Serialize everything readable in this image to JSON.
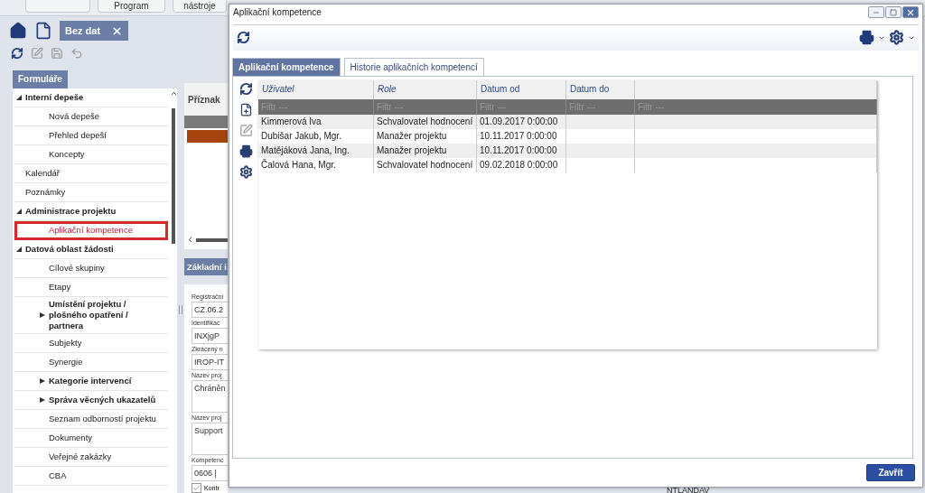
{
  "top_nav": [
    {
      "label": "Program"
    },
    {
      "label": "nástroje"
    }
  ],
  "open_tab": {
    "label": "Bez dat"
  },
  "forms_panel": {
    "title": "Formuláře",
    "tree": [
      {
        "label": "Interní depeše",
        "expanded": true,
        "selected": false,
        "children": [
          {
            "label": "Nová depeše",
            "selected": false
          },
          {
            "label": "Přehled depeší",
            "selected": false
          },
          {
            "label": "Koncepty",
            "selected": false
          }
        ]
      },
      {
        "label": "Kalendář",
        "selected": false
      },
      {
        "label": "Poznámky",
        "selected": false
      },
      {
        "label": "Administrace projektu",
        "expanded": true,
        "selected": false,
        "children": [
          {
            "label": "Aplikační kompetence",
            "selected": true
          }
        ]
      },
      {
        "label": "Datová oblast žádosti",
        "expanded": true,
        "selected": false,
        "children": [
          {
            "label": "Cílové skupiny",
            "selected": false
          },
          {
            "label": "Etapy",
            "selected": false
          },
          {
            "label": "Umístění projektu / plošného opatření / partnera",
            "expanded": false,
            "selected": false
          },
          {
            "label": "Subjekty",
            "selected": false
          },
          {
            "label": "Synergie",
            "selected": false
          },
          {
            "label": "Kategorie intervencí",
            "expanded": false,
            "selected": false
          },
          {
            "label": "Správa věcných ukazatelů",
            "expanded": false,
            "selected": false
          },
          {
            "label": "Seznam odborností projektu",
            "selected": false
          },
          {
            "label": "Dokumenty",
            "selected": false
          },
          {
            "label": "Veřejné zakázky",
            "selected": false
          },
          {
            "label": "CBA",
            "selected": false
          }
        ]
      }
    ]
  },
  "middle": {
    "column": "Příznak",
    "section": "Základní i",
    "fields": [
      {
        "label": "Registrační",
        "value": "CZ.06.2"
      },
      {
        "label": "Identifikac",
        "value": "INXjgP"
      },
      {
        "label": "Zkrácený n",
        "value": "IROP-IT"
      },
      {
        "label": "Název proj",
        "value": "Chráněn",
        "kind": "area"
      },
      {
        "label": "Název proj",
        "value": "Support",
        "kind": "area"
      },
      {
        "label": "Kompetenc",
        "value": "0606 |"
      }
    ],
    "checkbox": {
      "label": "Kontr",
      "checked": true
    }
  },
  "dialog": {
    "title": "Aplikační kompetence",
    "tabs": [
      {
        "label": "Aplikační kompetence",
        "selected": true
      },
      {
        "label": "Historie aplikačních kompetencí",
        "selected": false
      }
    ],
    "columns": [
      {
        "label": "Uživatel",
        "italic": true,
        "filter_placeholder": "Filtr ---"
      },
      {
        "label": "Role",
        "italic": true,
        "filter_placeholder": "Filtr ---"
      },
      {
        "label": "Datum od",
        "italic": false,
        "filter_placeholder": "Filtr ---"
      },
      {
        "label": "Datum do",
        "italic": false,
        "filter_placeholder": "Filtr ---"
      },
      {
        "filter_placeholder": "Filtr ---"
      }
    ],
    "rows": [
      [
        "Kimmerová Iva",
        "Schvalovatel hodnocení",
        "01.09.2017 0:00:00"
      ],
      [
        "Dubišar Jakub, Mgr.",
        "Manažer projektu",
        "10.11.2017 0:00:00"
      ],
      [
        "Matějáková Jana, Ing.",
        "Manažer projektu",
        "10.11.2017 0:00:00"
      ],
      [
        "Čalová Hana, Mgr.",
        "Schvalovatel hodnocení",
        "09.02.2018 0:00:00"
      ]
    ],
    "close_button": "Zavřít"
  },
  "background_cell": "NTLANDAV"
}
